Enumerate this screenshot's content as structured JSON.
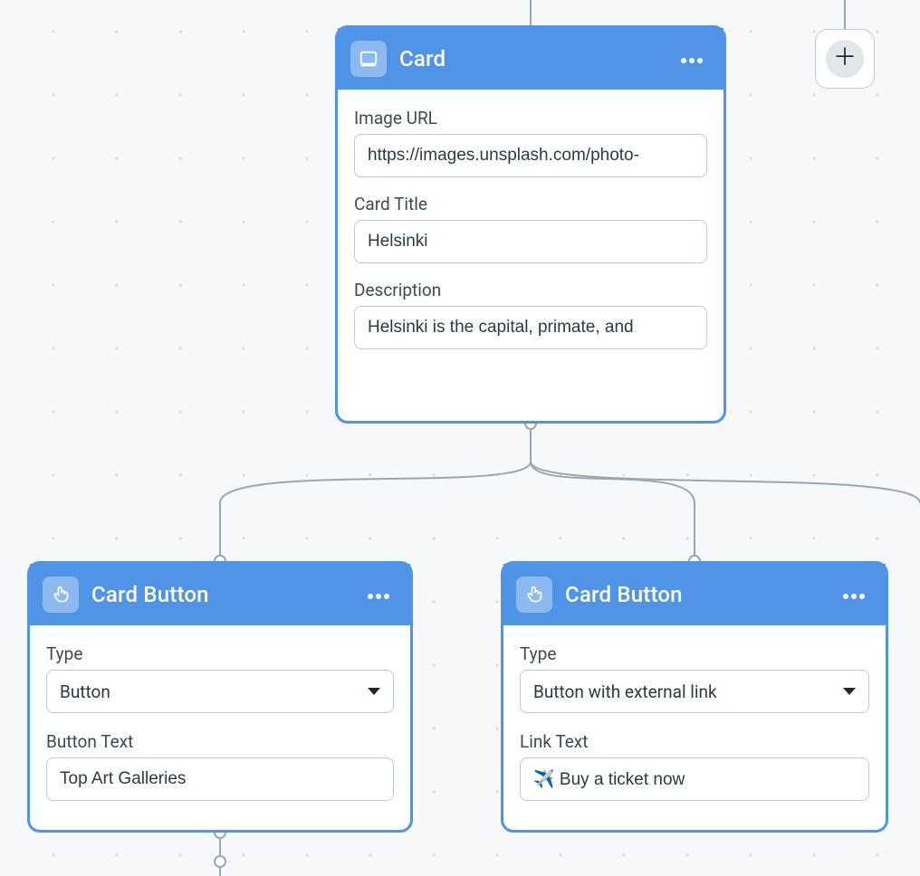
{
  "nodes": {
    "card": {
      "title": "Card",
      "fields": {
        "image_url": {
          "label": "Image URL",
          "value": "https://images.unsplash.com/photo-"
        },
        "card_title": {
          "label": "Card Title",
          "value": "Helsinki"
        },
        "description": {
          "label": "Description",
          "value": "Helsinki is the capital, primate, and"
        }
      }
    },
    "card_button_1": {
      "title": "Card Button",
      "fields": {
        "type": {
          "label": "Type",
          "value": "Button"
        },
        "button_text": {
          "label": "Button Text",
          "value": "Top Art Galleries"
        }
      }
    },
    "card_button_2": {
      "title": "Card Button",
      "fields": {
        "type": {
          "label": "Type",
          "value": "Button with external link"
        },
        "link_text": {
          "label": "Link Text",
          "value": "✈️ Buy a ticket now"
        }
      }
    }
  },
  "add_button": {
    "tooltip": "Add"
  }
}
